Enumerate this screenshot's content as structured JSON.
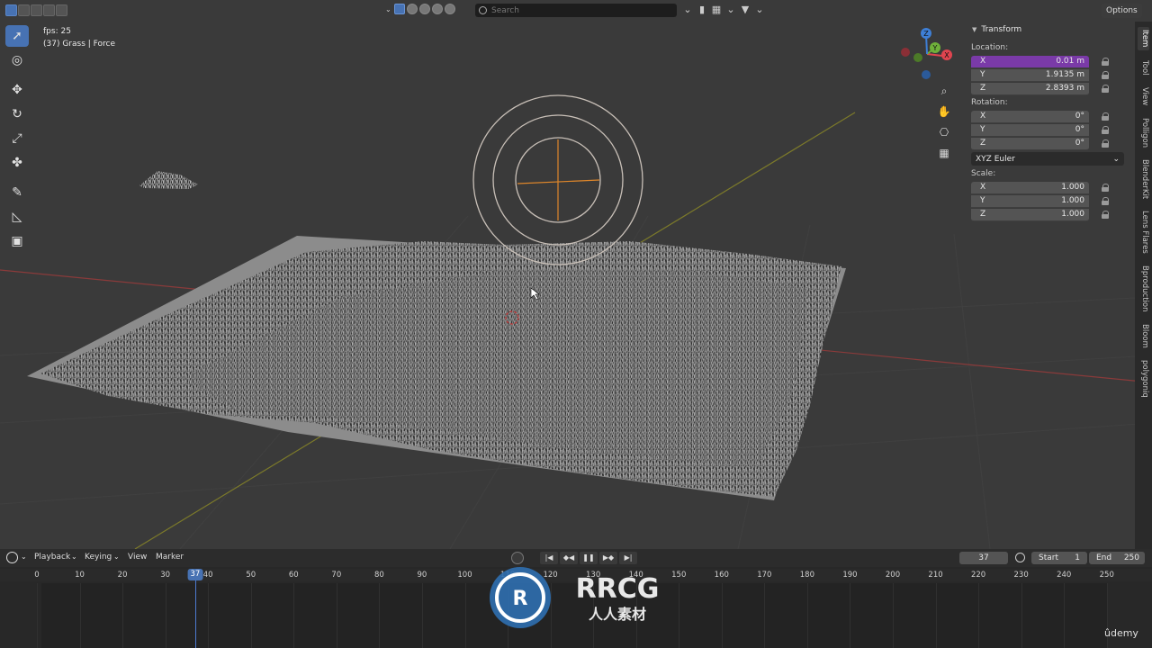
{
  "header": {
    "search_placeholder": "Search",
    "options_label": "Options"
  },
  "overlay": {
    "fps": "fps: 25",
    "object_info": "(37) Grass | Force"
  },
  "toolbar": {
    "tools": [
      "select-box",
      "cursor",
      "move",
      "rotate",
      "scale",
      "transform",
      "annotate",
      "measure",
      "add-cube"
    ]
  },
  "gizmo": {
    "axes": [
      "X",
      "Y",
      "Z"
    ],
    "colors": {
      "x": "#e0444f",
      "y": "#6fb03a",
      "z": "#3e7fd6"
    }
  },
  "npanel": {
    "title": "Transform",
    "location_label": "Location:",
    "location": [
      {
        "axis": "X",
        "value": "0.01 m"
      },
      {
        "axis": "Y",
        "value": "1.9135 m"
      },
      {
        "axis": "Z",
        "value": "2.8393 m"
      }
    ],
    "rotation_label": "Rotation:",
    "rotation": [
      {
        "axis": "X",
        "value": "0°"
      },
      {
        "axis": "Y",
        "value": "0°"
      },
      {
        "axis": "Z",
        "value": "0°"
      }
    ],
    "rotation_mode": "XYZ Euler",
    "scale_label": "Scale:",
    "scale": [
      {
        "axis": "X",
        "value": "1.000"
      },
      {
        "axis": "Y",
        "value": "1.000"
      },
      {
        "axis": "Z",
        "value": "1.000"
      }
    ],
    "highlight_color": "#7a3aa8"
  },
  "side_tabs": [
    "Item",
    "Tool",
    "View",
    "Polligon",
    "BlenderKit",
    "Lens Flares",
    "Bproduction",
    "Bloom",
    "polygoniq"
  ],
  "timeline": {
    "menus": [
      "Playback",
      "Keying",
      "View",
      "Marker"
    ],
    "current_frame": "37",
    "start_label": "Start",
    "start_value": "1",
    "end_label": "End",
    "end_value": "250",
    "ticks": [
      "0",
      "10",
      "20",
      "30",
      "40",
      "50",
      "60",
      "70",
      "80",
      "90",
      "100",
      "110",
      "120",
      "130",
      "140",
      "150",
      "160",
      "170",
      "180",
      "190",
      "200",
      "210",
      "220",
      "230",
      "240",
      "250"
    ],
    "playhead": "37",
    "accent": "#4772b3"
  },
  "watermark": {
    "logo_text": "RRCG",
    "sub_text": "人人素材",
    "udemy": "ûdemy"
  }
}
